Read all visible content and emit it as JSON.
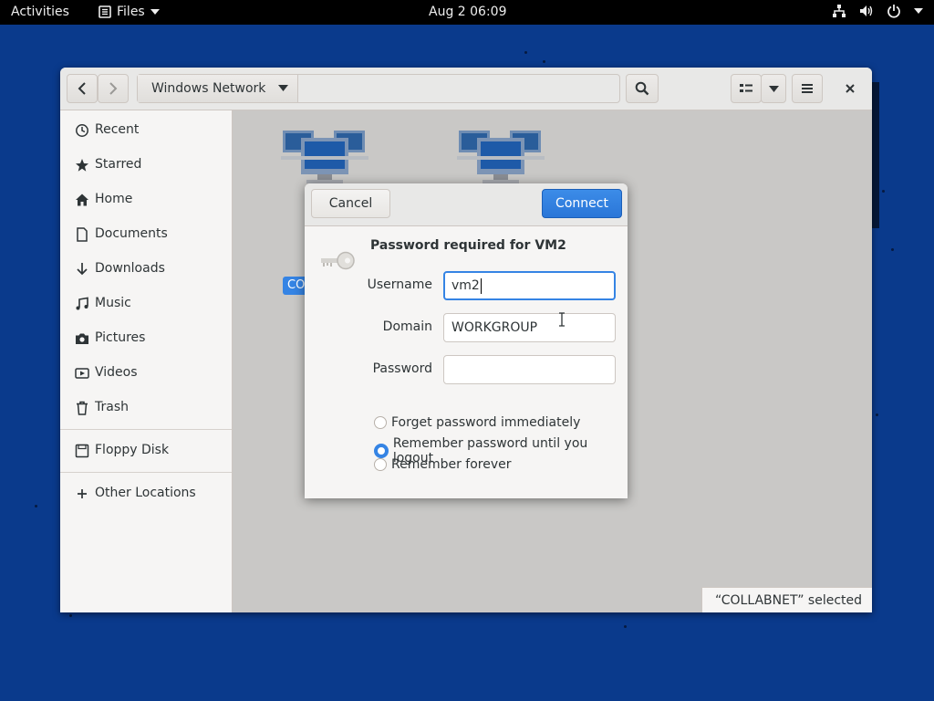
{
  "topbar": {
    "activities": "Activities",
    "app_name": "Files",
    "clock": "Aug 2  06:09"
  },
  "window": {
    "location": "Windows Network",
    "status": "“COLLABNET” selected",
    "selected_item_label": "CO"
  },
  "sidebar": {
    "items": [
      {
        "label": "Recent",
        "icon": "clock-icon"
      },
      {
        "label": "Starred",
        "icon": "star-icon"
      },
      {
        "label": "Home",
        "icon": "home-icon"
      },
      {
        "label": "Documents",
        "icon": "document-icon"
      },
      {
        "label": "Downloads",
        "icon": "download-icon"
      },
      {
        "label": "Music",
        "icon": "music-icon"
      },
      {
        "label": "Pictures",
        "icon": "camera-icon"
      },
      {
        "label": "Videos",
        "icon": "video-icon"
      },
      {
        "label": "Trash",
        "icon": "trash-icon"
      }
    ],
    "devices": [
      {
        "label": "Floppy Disk",
        "icon": "floppy-icon"
      }
    ],
    "other": {
      "label": "Other Locations",
      "icon": "plus-icon"
    }
  },
  "dialog": {
    "cancel_label": "Cancel",
    "connect_label": "Connect",
    "title": "Password required for VM2",
    "username_label": "Username",
    "username_value": "vm2",
    "domain_label": "Domain",
    "domain_value": "WORKGROUP",
    "password_label": "Password",
    "password_value": "",
    "options": [
      {
        "label": "Forget password immediately",
        "checked": false
      },
      {
        "label": "Remember password until you logout",
        "checked": true
      },
      {
        "label": "Remember forever",
        "checked": false
      }
    ]
  },
  "colors": {
    "accent": "#3584e4",
    "desktop": "#0a3a8c"
  }
}
